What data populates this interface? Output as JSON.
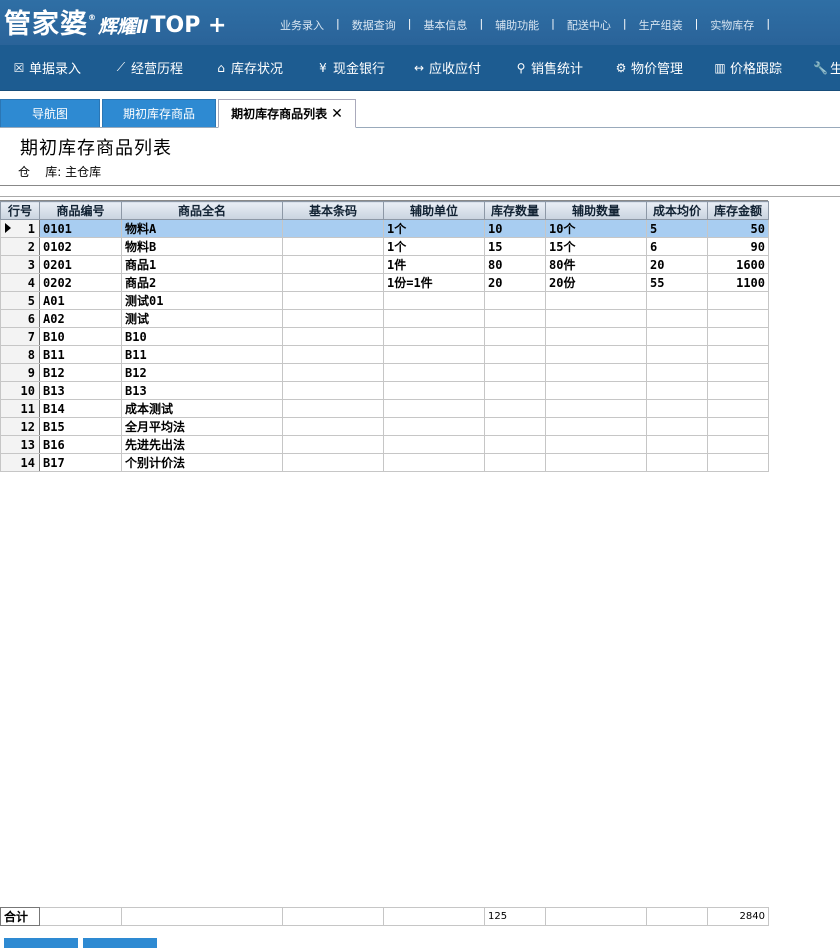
{
  "header": {
    "logo_main": "管家婆",
    "logo_reg": "®",
    "logo_sub": "辉耀Ⅱ",
    "logo_top": "TOP +",
    "top_menu": [
      "业务录入",
      "数据查询",
      "基本信息",
      "辅助功能",
      "配送中心",
      "生产组装",
      "实物库存"
    ]
  },
  "nav": [
    {
      "icon": "document-icon",
      "glyph": "☒",
      "label": "单据录入"
    },
    {
      "icon": "chart-line-icon",
      "glyph": "⟋",
      "label": "经营历程"
    },
    {
      "icon": "home-icon",
      "glyph": "⌂",
      "label": "库存状况"
    },
    {
      "icon": "yen-icon",
      "glyph": "¥",
      "label": "现金银行"
    },
    {
      "icon": "exchange-icon",
      "glyph": "↔",
      "label": "应收应付"
    },
    {
      "icon": "search-icon",
      "glyph": "⚲",
      "label": "销售统计"
    },
    {
      "icon": "gear-icon",
      "glyph": "⚙",
      "label": "物价管理"
    },
    {
      "icon": "bar-chart-icon",
      "glyph": "▥",
      "label": "价格跟踪"
    },
    {
      "icon": "wrench-icon",
      "glyph": "🔧",
      "label": "生"
    }
  ],
  "tabs": [
    {
      "label": "导航图"
    },
    {
      "label": "期初库存商品"
    },
    {
      "label": "期初库存商品列表",
      "close": "✕"
    }
  ],
  "page": {
    "title": "期初库存商品列表",
    "warehouse_label": "仓    库:",
    "warehouse_value": "主仓库"
  },
  "table": {
    "columns": [
      "行号",
      "商品编号",
      "商品全名",
      "基本条码",
      "辅助单位",
      "库存数量",
      "辅助数量",
      "成本均价",
      "库存金额"
    ],
    "rows": [
      [
        "1",
        "0101",
        "物料A",
        "",
        "1个",
        "10",
        "10个",
        "5",
        "50"
      ],
      [
        "2",
        "0102",
        "物料B",
        "",
        "1个",
        "15",
        "15个",
        "6",
        "90"
      ],
      [
        "3",
        "0201",
        "商品1",
        "",
        "1件",
        "80",
        "80件",
        "20",
        "1600"
      ],
      [
        "4",
        "0202",
        "商品2",
        "",
        "1份=1件",
        "20",
        "20份",
        "55",
        "1100"
      ],
      [
        "5",
        "A01",
        "测试01",
        "",
        "",
        "",
        "",
        "",
        ""
      ],
      [
        "6",
        "A02",
        "测试",
        "",
        "",
        "",
        "",
        "",
        ""
      ],
      [
        "7",
        "B10",
        "B10",
        "",
        "",
        "",
        "",
        "",
        ""
      ],
      [
        "8",
        "B11",
        "B11",
        "",
        "",
        "",
        "",
        "",
        ""
      ],
      [
        "9",
        "B12",
        "B12",
        "",
        "",
        "",
        "",
        "",
        ""
      ],
      [
        "10",
        "B13",
        "B13",
        "",
        "",
        "",
        "",
        "",
        ""
      ],
      [
        "11",
        "B14",
        "成本测试",
        "",
        "",
        "",
        "",
        "",
        ""
      ],
      [
        "12",
        "B15",
        "全月平均法",
        "",
        "",
        "",
        "",
        "",
        ""
      ],
      [
        "13",
        "B16",
        "先进先出法",
        "",
        "",
        "",
        "",
        "",
        ""
      ],
      [
        "14",
        "B17",
        "个别计价法",
        "",
        "",
        "",
        "",
        "",
        ""
      ]
    ],
    "selected_row": 0
  },
  "totals": {
    "label": "合计",
    "qty": "125",
    "amount": "2840"
  },
  "colors": {
    "header_bg": "#2a6399",
    "nav_bg": "#1d5c91",
    "tab_bg": "#2e8ad2",
    "selected_row": "#a8cdf1"
  }
}
